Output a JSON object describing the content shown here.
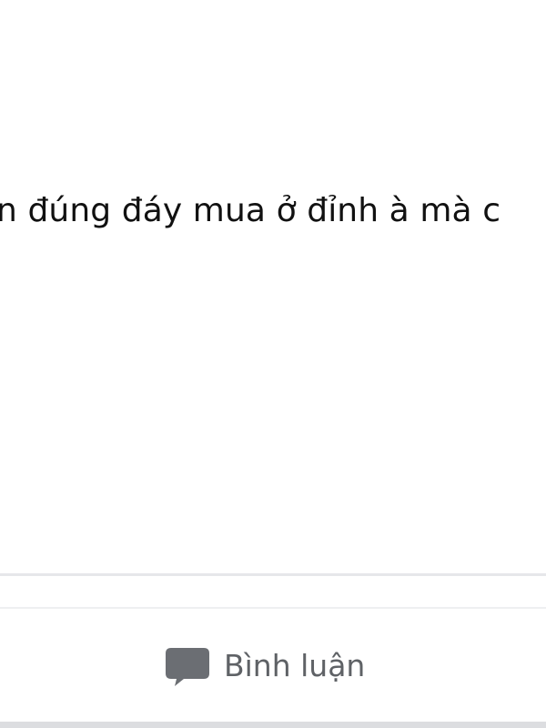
{
  "post": {
    "text": "n đúng đáy mua ở đỉnh à mà c"
  },
  "actions": {
    "comment_label": "Bình luận",
    "comment_icon": "speech-bubble-icon"
  },
  "colors": {
    "text": "#111111",
    "action_text": "#5f6266",
    "icon": "#6b6e73",
    "divider": "#e6e7ea"
  }
}
